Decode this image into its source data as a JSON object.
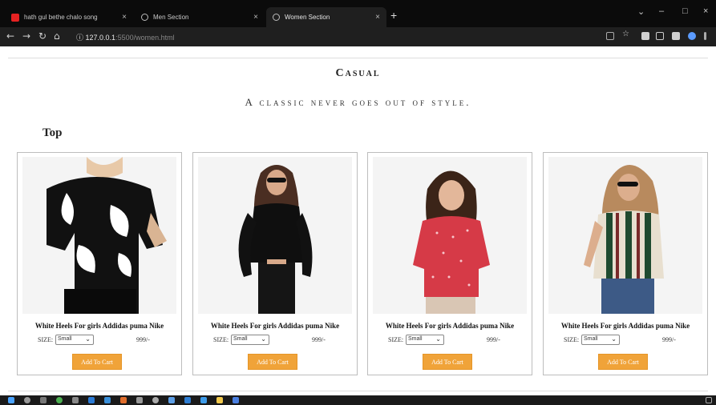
{
  "browser": {
    "tabs": [
      {
        "title": "hath gul bethe chalo song",
        "icon": "youtube-icon"
      },
      {
        "title": "Men Section",
        "icon": "globe-icon"
      },
      {
        "title": "Women Section",
        "icon": "globe-icon"
      }
    ],
    "url": "127.0.0.1",
    "url_rest": ":5500/women.html"
  },
  "page": {
    "title": "Casual",
    "subtitle": "A classic never goes out of style.",
    "section": "Top"
  },
  "products": [
    {
      "name": "White Heels For girls Addidas puma Nike",
      "size_label": "SIZE:",
      "size": "Small",
      "price": "999/-",
      "button": "Add To Cart"
    },
    {
      "name": "White Heels For girls Addidas puma Nike",
      "size_label": "SIZE:",
      "size": "Small",
      "price": "999/-",
      "button": "Add To Cart"
    },
    {
      "name": "White Heels For girls Addidas puma Nike",
      "size_label": "SIZE:",
      "size": "Small",
      "price": "999/-",
      "button": "Add To Cart"
    },
    {
      "name": "White Heels For girls Addidas puma Nike",
      "size_label": "SIZE:",
      "size": "Small",
      "price": "999/-",
      "button": "Add To Cart"
    }
  ],
  "colors": {
    "accent": "#f0a339",
    "browser_dark": "#1f1f1f"
  }
}
